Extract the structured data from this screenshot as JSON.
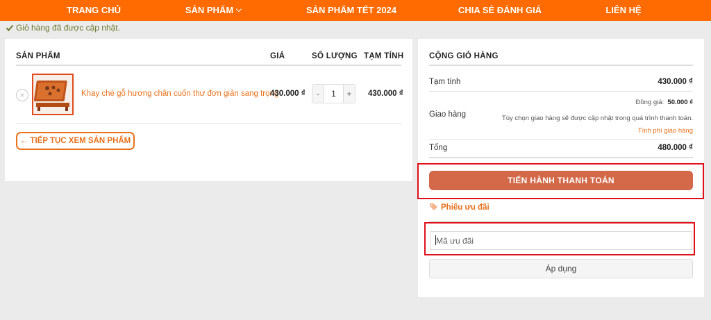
{
  "nav": {
    "items": [
      {
        "label": "TRANG CHỦ"
      },
      {
        "label": "SẢN PHẨM"
      },
      {
        "label": "SẢN PHẨM TẾT 2024"
      },
      {
        "label": "CHIA SẺ ĐÁNH GIÁ"
      },
      {
        "label": "LIÊN HỆ"
      }
    ]
  },
  "notice": {
    "text": "Giỏ hàng đã được cập nhật."
  },
  "cart": {
    "headers": {
      "product": "SẢN PHẨM",
      "price": "GIÁ",
      "quantity": "SỐ LƯỢNG",
      "subtotal": "TẠM TÍNH"
    },
    "item": {
      "remove": "×",
      "name": "Khay chè gỗ hương chân cuốn thư đơn giản sang trọng",
      "price": "430.000 ₫",
      "qty_minus": "-",
      "quantity": "1",
      "qty_plus": "+",
      "subtotal": "430.000 ₫"
    },
    "continue_label": "← TIẾP TỤC XEM SẢN PHẨM"
  },
  "totals": {
    "title": "CỘNG GIỎ HÀNG",
    "subtotal_label": "Tạm tính",
    "subtotal_value": "430.000 ₫",
    "shipping_label": "Giao hàng",
    "shipping_price_label": "Đồng giá:",
    "shipping_price_value": "50.000 ₫",
    "shipping_note": "Tùy chọn giao hàng sẽ được cập nhật trong quá trình thanh toán.",
    "shipping_calc_link": "Tính phí giao hàng",
    "total_label": "Tổng",
    "total_value": "480.000 ₫",
    "checkout_label": "TIẾN HÀNH THANH TOÁN"
  },
  "coupon": {
    "title": "Phiếu ưu đãi",
    "placeholder": "Mã ưu đãi",
    "apply_label": "Áp dụng"
  },
  "colors": {
    "nav_bg": "#ff6b00",
    "accent": "#e8711c",
    "checkout_bg": "#d4694a",
    "highlight": "#e0101a",
    "notice": "#6b7b2e"
  },
  "icons": {
    "notice": "check-icon",
    "dropdown": "chevron-down-icon",
    "coupon": "tag-icon",
    "remove": "close-icon"
  }
}
